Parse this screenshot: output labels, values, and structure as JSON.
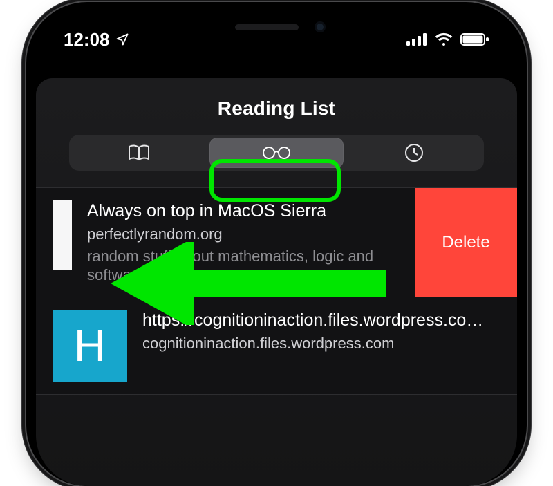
{
  "status": {
    "time": "12:08"
  },
  "sheet": {
    "title": "Reading List"
  },
  "tabs": {
    "selected": 1
  },
  "rows": [
    {
      "title": "Always on top in MacOS Sierra",
      "site": "perfectlyrandom.org",
      "desc": "random stuff about mathematics, logic and software",
      "delete_label": "Delete"
    },
    {
      "title": "https://cognitioninaction.files.wordpress.co…",
      "site": "cognitioninaction.files.wordpress.com",
      "avatar_letter": "H"
    }
  ]
}
